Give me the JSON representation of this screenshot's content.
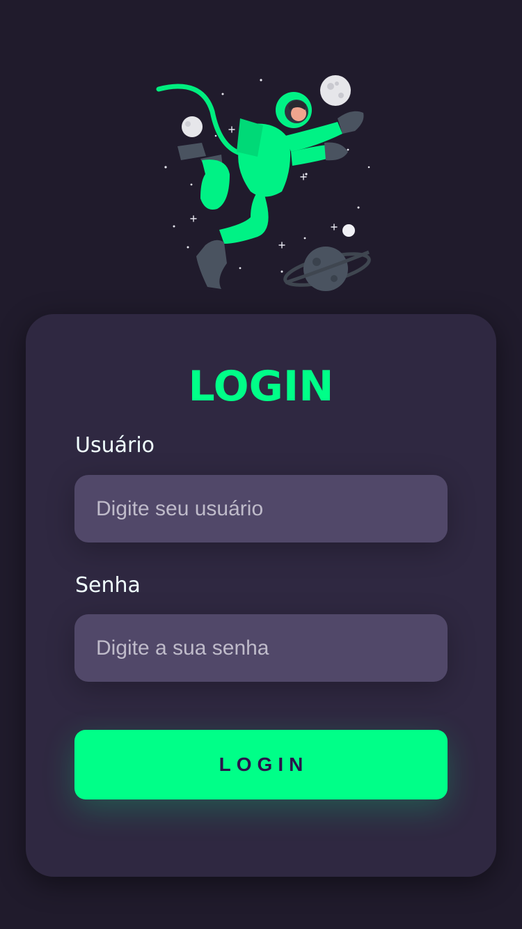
{
  "colors": {
    "background": "#201b2c",
    "card": "#2f2841",
    "accent": "#00ff88",
    "input_bg": "#514869",
    "button_text": "#2b134b",
    "label_text": "#f0ffff"
  },
  "hero": {
    "icon": "astronaut-illustration"
  },
  "login": {
    "title": "LOGIN",
    "username_label": "Usuário",
    "username_placeholder": "Digite seu usuário",
    "password_label": "Senha",
    "password_placeholder": "Digite a sua senha",
    "submit_label": "LOGIN"
  }
}
